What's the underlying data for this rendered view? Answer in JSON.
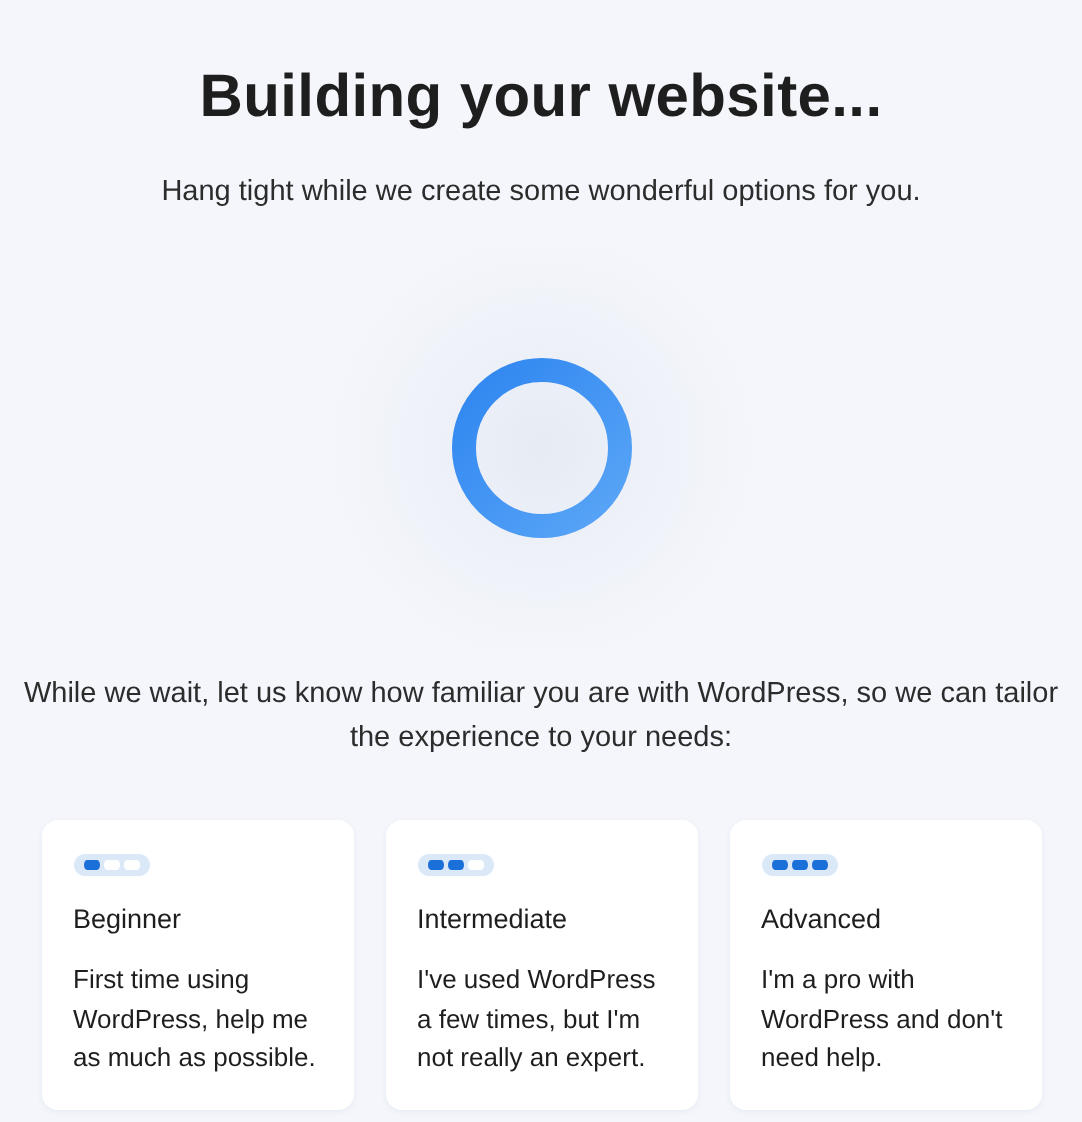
{
  "title": "Building your website...",
  "subtitle": "Hang tight while we create some wonderful options for you.",
  "question": "While we wait, let us know how familiar you are with WordPress, so we can tailor the experience to your needs:",
  "options": [
    {
      "label": "Beginner",
      "description": "First time using WordPress, help me as much as possible.",
      "stars": 1
    },
    {
      "label": "Intermediate",
      "description": "I've used WordPress a few times, but I'm not really an expert.",
      "stars": 2
    },
    {
      "label": "Advanced",
      "description": "I'm a pro with WordPress and don't need help.",
      "stars": 3
    }
  ]
}
